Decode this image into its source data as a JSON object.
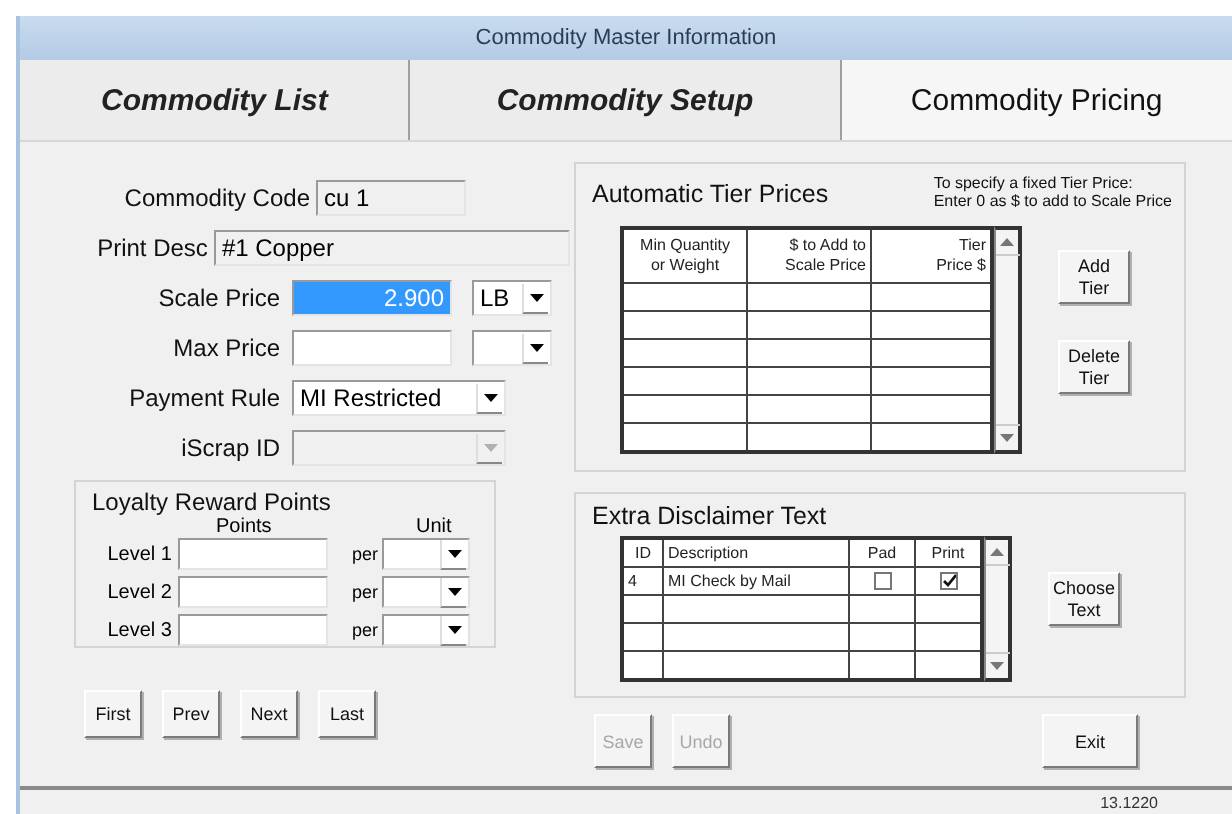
{
  "window": {
    "title": "Commodity Master Information"
  },
  "tabs": [
    {
      "label": "Commodity List",
      "selected": false
    },
    {
      "label": "Commodity Setup",
      "selected": false
    },
    {
      "label": "Commodity Pricing",
      "selected": true
    }
  ],
  "fields": [
    {
      "kind": "text",
      "label": "Commodity Code",
      "value": "cu 1"
    },
    {
      "kind": "text",
      "label": "Print Desc",
      "value": "#1 Copper"
    },
    {
      "kind": "price",
      "label": "Scale Price",
      "value": "2.900",
      "selected": true,
      "unit": "LB"
    },
    {
      "kind": "price",
      "label": "Max Price",
      "selected": false
    },
    {
      "kind": "select",
      "label": "Payment Rule",
      "value": "MI Restricted",
      "disabled": false
    },
    {
      "kind": "select",
      "label": "iScrap ID",
      "disabled": true
    }
  ],
  "loyalty": {
    "title": "Loyalty Reward Points",
    "columns": [
      "Points",
      "Unit"
    ],
    "levels": [
      {
        "label": "Level 1",
        "per": "per"
      },
      {
        "label": "Level 2",
        "per": "per"
      },
      {
        "label": "Level 3",
        "per": "per"
      }
    ]
  },
  "nav_buttons": [
    "First",
    "Prev",
    "Next",
    "Last"
  ],
  "tier_prices": {
    "title": "Automatic Tier Prices",
    "note": [
      "To specify a fixed Tier Price:",
      "Enter 0 as $ to add to Scale Price"
    ],
    "columns": [
      [
        "Min Quantity",
        "or Weight"
      ],
      [
        "$ to Add to",
        "Scale Price"
      ],
      [
        "Tier",
        "Price $"
      ]
    ],
    "buttons": [
      "Add Tier",
      "Delete Tier"
    ]
  },
  "disclaimer": {
    "title": "Extra Disclaimer Text",
    "columns": [
      "ID",
      "Description",
      "Pad",
      "Print"
    ],
    "rows": [
      {
        "id": "4",
        "description": "MI Check by Mail",
        "pad": false,
        "print": true
      }
    ],
    "button": "Choose Text"
  },
  "footer_buttons": [
    {
      "label": "Save",
      "disabled": true
    },
    {
      "label": "Undo",
      "disabled": true
    },
    {
      "label": "Exit",
      "disabled": false
    }
  ],
  "status_bar": {
    "version": "13.1220"
  }
}
